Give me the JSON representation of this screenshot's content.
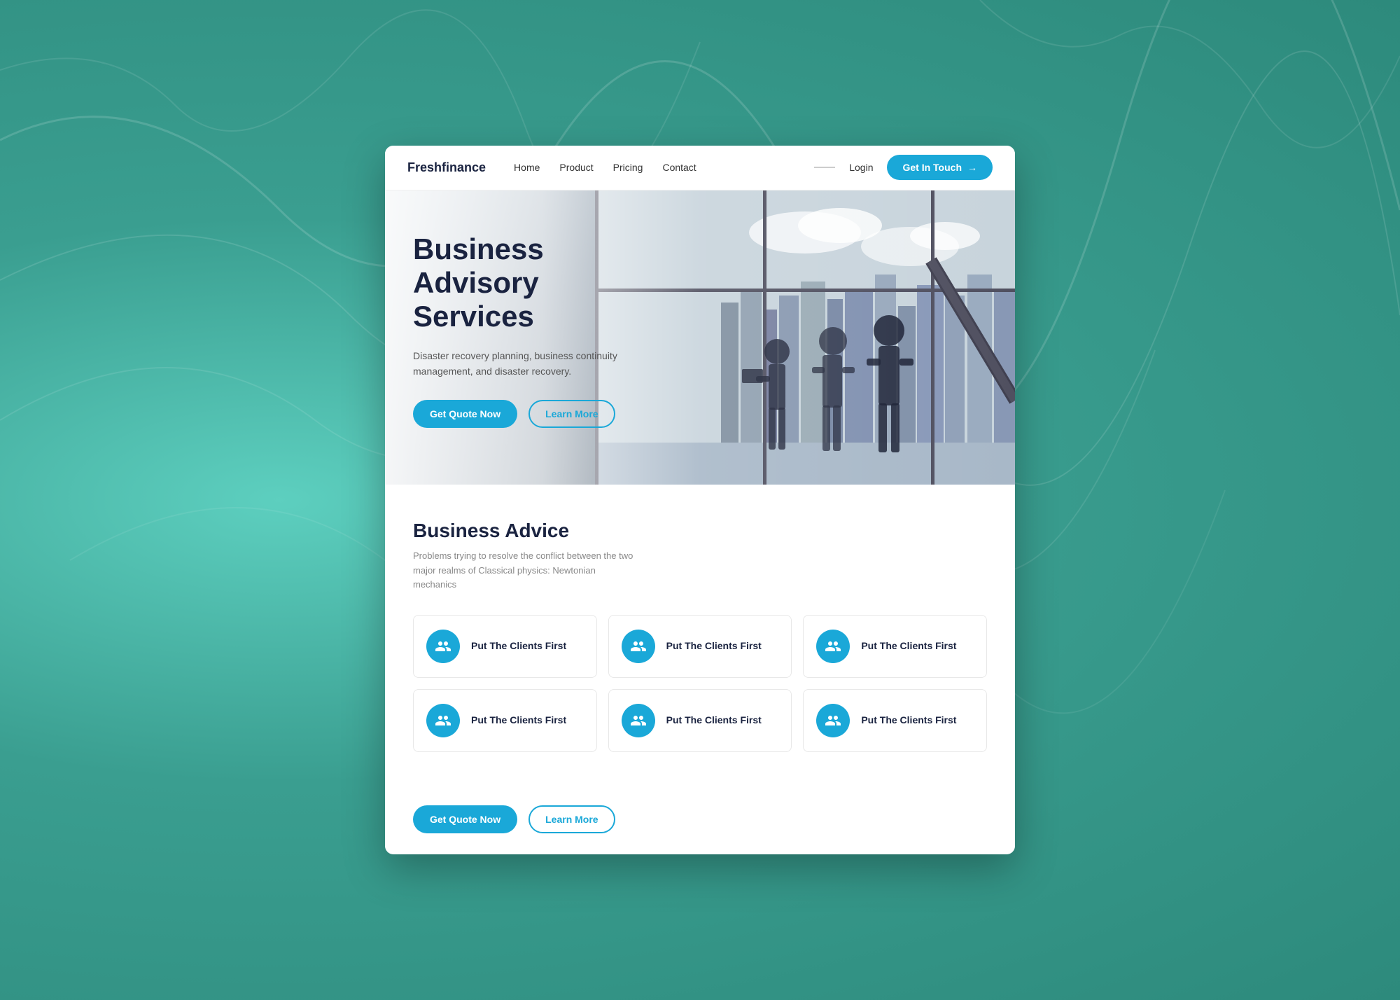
{
  "brand": "Freshfinance",
  "nav": {
    "items": [
      {
        "label": "Home",
        "active": true
      },
      {
        "label": "Product"
      },
      {
        "label": "Pricing"
      },
      {
        "label": "Contact"
      }
    ],
    "login": "Login",
    "cta": "Get In Touch"
  },
  "hero": {
    "title_line1": "Business Advisory",
    "title_line2": "Services",
    "subtitle": "Disaster recovery planning, business continuity management, and disaster recovery.",
    "btn_quote": "Get Quote Now",
    "btn_learn": "Learn More"
  },
  "advice": {
    "section_title": "Business Advice",
    "section_subtitle": "Problems trying to resolve the conflict between the two major realms of Classical physics: Newtonian mechanics",
    "cards": [
      {
        "label": "Put The Clients First"
      },
      {
        "label": "Put The Clients First"
      },
      {
        "label": "Put The Clients First"
      },
      {
        "label": "Put The Clients First"
      },
      {
        "label": "Put The Clients First"
      },
      {
        "label": "Put The Clients First"
      }
    ],
    "btn_quote": "Get Quote Now",
    "btn_learn": "Learn More"
  }
}
